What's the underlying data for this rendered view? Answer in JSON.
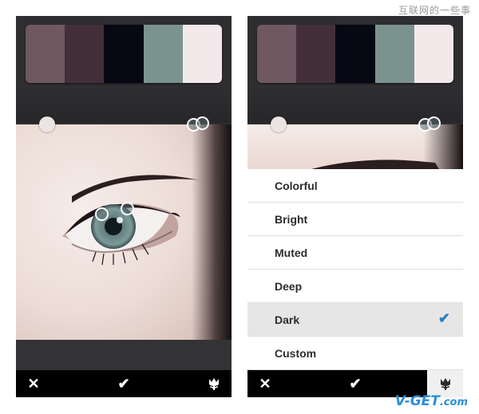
{
  "watermarks": {
    "top": "互联网的一些事",
    "bottom_brand": "V-GET",
    "bottom_domain": ".com"
  },
  "palette": {
    "colors": [
      "#6f5860",
      "#432f39",
      "#060914",
      "#7b938f",
      "#f3e8ea"
    ]
  },
  "left_screen": {
    "toolbar": {
      "cancel_icon": "close-icon",
      "confirm_icon": "checkmark-icon",
      "filter_icon": "tulip-icon"
    }
  },
  "right_screen": {
    "menu": {
      "items": [
        {
          "label": "Colorful",
          "selected": false
        },
        {
          "label": "Bright",
          "selected": false
        },
        {
          "label": "Muted",
          "selected": false
        },
        {
          "label": "Deep",
          "selected": false
        },
        {
          "label": "Dark",
          "selected": true
        },
        {
          "label": "Custom",
          "selected": false
        }
      ]
    },
    "toolbar": {
      "cancel_icon": "close-icon",
      "confirm_icon": "checkmark-icon",
      "filter_icon": "tulip-icon"
    }
  },
  "colors": {
    "accent_check": "#2c7fc4",
    "chrome_dark": "#2e2e30",
    "toolbar": "#000000"
  }
}
